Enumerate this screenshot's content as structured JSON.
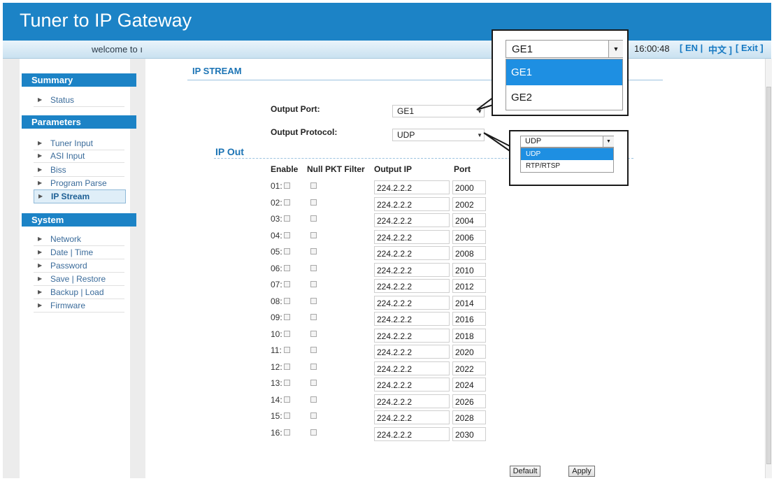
{
  "header": {
    "title": "Tuner to IP Gateway"
  },
  "topbar": {
    "welcome": "welcome to ı",
    "time": "16:00:48",
    "lang_en": "[ EN |",
    "lang_cn": "中文 ]",
    "exit": "[ Exit ]"
  },
  "sidebar": {
    "sections": [
      {
        "title": "Summary",
        "items": [
          "Status"
        ]
      },
      {
        "title": "Parameters",
        "items": [
          "Tuner Input",
          "ASI Input",
          "Biss",
          "Program Parse",
          "IP Stream"
        ]
      },
      {
        "title": "System",
        "items": [
          "Network",
          "Date | Time",
          "Password",
          "Save | Restore",
          "Backup | Load",
          "Firmware"
        ]
      }
    ],
    "active_item": "IP Stream"
  },
  "main": {
    "title": "IP STREAM",
    "output_port_label": "Output Port:",
    "output_port_value": "GE1",
    "output_protocol_label": "Output Protocol:",
    "output_protocol_value": "UDP",
    "ip_out_title": "IP Out",
    "columns": [
      "Enable",
      "Null PKT Filter",
      "Output IP",
      "Port"
    ],
    "rows": [
      {
        "no": "01:",
        "ip": "224.2.2.2",
        "port": "2000"
      },
      {
        "no": "02:",
        "ip": "224.2.2.2",
        "port": "2002"
      },
      {
        "no": "03:",
        "ip": "224.2.2.2",
        "port": "2004"
      },
      {
        "no": "04:",
        "ip": "224.2.2.2",
        "port": "2006"
      },
      {
        "no": "05:",
        "ip": "224.2.2.2",
        "port": "2008"
      },
      {
        "no": "06:",
        "ip": "224.2.2.2",
        "port": "2010"
      },
      {
        "no": "07:",
        "ip": "224.2.2.2",
        "port": "2012"
      },
      {
        "no": "08:",
        "ip": "224.2.2.2",
        "port": "2014"
      },
      {
        "no": "09:",
        "ip": "224.2.2.2",
        "port": "2016"
      },
      {
        "no": "10:",
        "ip": "224.2.2.2",
        "port": "2018"
      },
      {
        "no": "11:",
        "ip": "224.2.2.2",
        "port": "2020"
      },
      {
        "no": "12:",
        "ip": "224.2.2.2",
        "port": "2022"
      },
      {
        "no": "13:",
        "ip": "224.2.2.2",
        "port": "2024"
      },
      {
        "no": "14:",
        "ip": "224.2.2.2",
        "port": "2026"
      },
      {
        "no": "15:",
        "ip": "224.2.2.2",
        "port": "2028"
      },
      {
        "no": "16:",
        "ip": "224.2.2.2",
        "port": "2030"
      }
    ],
    "default_button": "Default",
    "apply_button": "Apply"
  },
  "port_callout": {
    "selected": "GE1",
    "options": [
      "GE1",
      "GE2"
    ],
    "highlighted": "GE1"
  },
  "protocol_callout": {
    "selected": "UDP",
    "options": [
      "UDP",
      "RTP/RTSP"
    ],
    "highlighted": "UDP"
  },
  "colors": {
    "brand_blue": "#1c83c6",
    "highlight_blue": "#1e8fe2",
    "link_blue": "#1679c2"
  }
}
